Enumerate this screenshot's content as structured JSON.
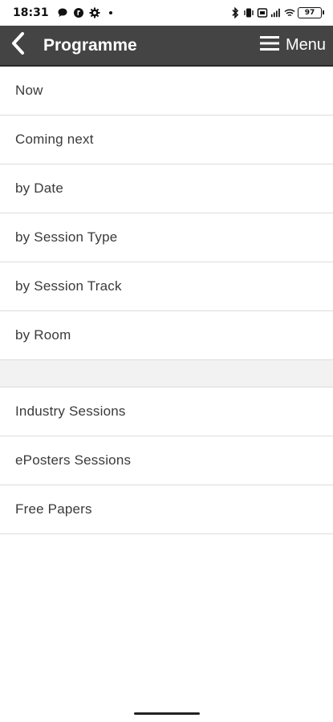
{
  "status_bar": {
    "time": "18:31",
    "battery": "97"
  },
  "header": {
    "title": "Programme",
    "menu_label": "Menu",
    "back_icon": "chevron-left-icon",
    "menu_icon": "hamburger-icon"
  },
  "list_groups": [
    {
      "items": [
        {
          "label": "Now"
        },
        {
          "label": "Coming next"
        },
        {
          "label": "by Date"
        },
        {
          "label": "by Session Type"
        },
        {
          "label": "by Session Track"
        },
        {
          "label": "by Room"
        }
      ]
    },
    {
      "items": [
        {
          "label": "Industry Sessions"
        },
        {
          "label": "ePosters Sessions"
        },
        {
          "label": "Free Papers"
        }
      ]
    }
  ],
  "colors": {
    "header_bg": "#444444",
    "header_text": "#ffffff",
    "item_text": "#3a3a3a",
    "divider": "#dcdcdc",
    "spacer_bg": "#f2f2f2"
  }
}
